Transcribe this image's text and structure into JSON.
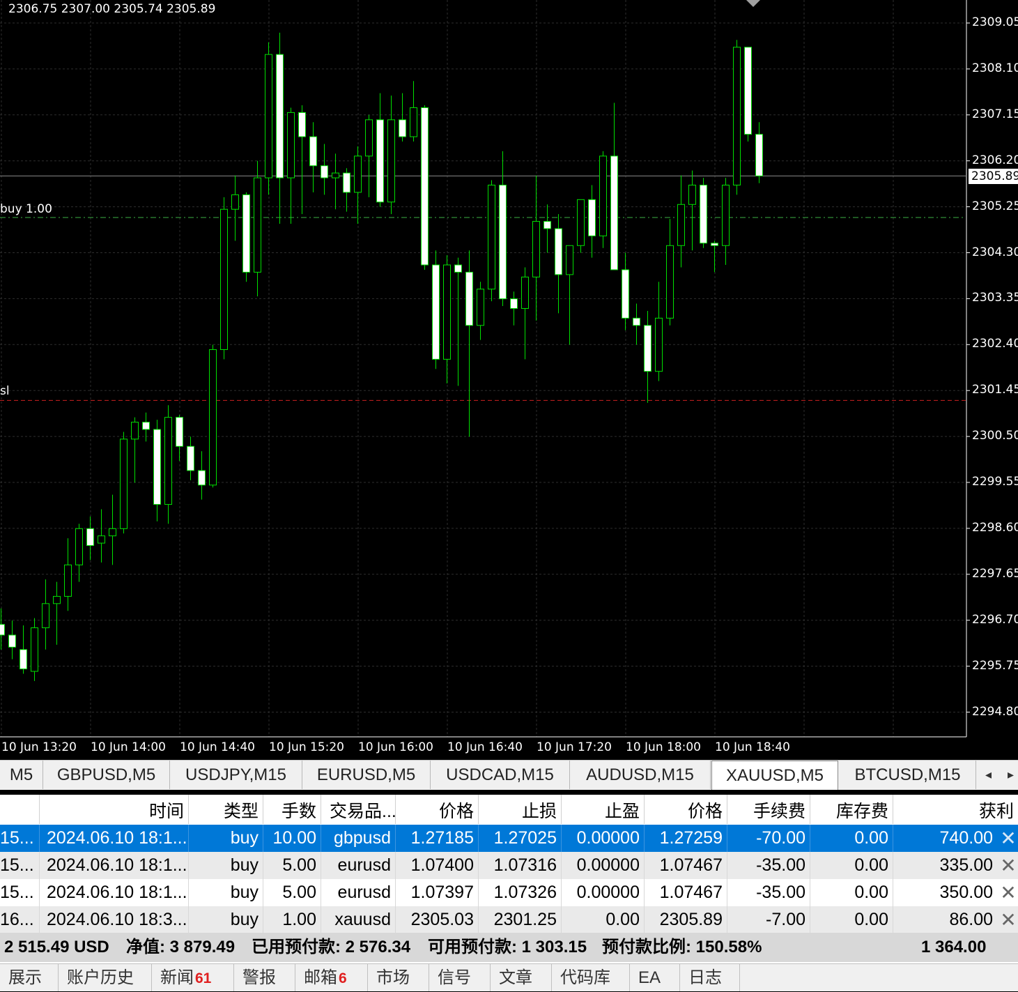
{
  "chart": {
    "ohlc_text": "2306.75 2307.00 2305.74 2305.89",
    "bid_price": "2305.89",
    "order_line_label": "buy 1.00",
    "sl_line_label": "sl",
    "y_labels": [
      "2309.05",
      "2308.10",
      "2307.15",
      "2306.20",
      "2305.25",
      "2304.30",
      "2303.35",
      "2302.40",
      "2301.45",
      "2300.50",
      "2299.55",
      "2298.60",
      "2297.65",
      "2296.70",
      "2295.75",
      "2294.80"
    ],
    "x_labels": [
      "10 Jun 13:20",
      "10 Jun 14:00",
      "10 Jun 14:40",
      "10 Jun 15:20",
      "10 Jun 16:00",
      "10 Jun 16:40",
      "10 Jun 17:20",
      "10 Jun 18:00",
      "10 Jun 18:40"
    ],
    "colors": {
      "background": "#000000",
      "grid": "#2e2e2e",
      "candle_outline": "#00e000",
      "bull_body": "#000000",
      "bear_body": "#ffffff",
      "order_line": "#3cb043",
      "sl_line": "#cc2020"
    }
  },
  "chart_data": {
    "type": "candlestick",
    "symbol": "XAUUSD",
    "timeframe": "M5",
    "ylim": [
      2294.3,
      2309.4
    ],
    "order_level": 2305.03,
    "sl_level": 2301.25,
    "bid": 2305.89,
    "candles": [
      {
        "o": 2296.62,
        "h": 2296.95,
        "l": 2296.1,
        "c": 2296.4
      },
      {
        "o": 2296.4,
        "h": 2296.7,
        "l": 2295.9,
        "c": 2296.15
      },
      {
        "o": 2296.1,
        "h": 2296.6,
        "l": 2295.6,
        "c": 2295.7
      },
      {
        "o": 2295.65,
        "h": 2296.75,
        "l": 2295.45,
        "c": 2296.55
      },
      {
        "o": 2296.55,
        "h": 2297.55,
        "l": 2296.1,
        "c": 2297.05
      },
      {
        "o": 2297.05,
        "h": 2297.5,
        "l": 2296.2,
        "c": 2297.2
      },
      {
        "o": 2297.2,
        "h": 2298.4,
        "l": 2296.9,
        "c": 2297.85
      },
      {
        "o": 2297.85,
        "h": 2298.7,
        "l": 2297.5,
        "c": 2298.6
      },
      {
        "o": 2298.6,
        "h": 2298.85,
        "l": 2297.95,
        "c": 2298.25
      },
      {
        "o": 2298.3,
        "h": 2299.0,
        "l": 2297.9,
        "c": 2298.45
      },
      {
        "o": 2298.45,
        "h": 2299.3,
        "l": 2297.85,
        "c": 2298.6
      },
      {
        "o": 2298.6,
        "h": 2300.6,
        "l": 2298.5,
        "c": 2300.45
      },
      {
        "o": 2300.45,
        "h": 2300.9,
        "l": 2299.55,
        "c": 2300.8
      },
      {
        "o": 2300.8,
        "h": 2301.0,
        "l": 2300.4,
        "c": 2300.65
      },
      {
        "o": 2300.65,
        "h": 2300.85,
        "l": 2298.75,
        "c": 2299.1
      },
      {
        "o": 2299.1,
        "h": 2301.15,
        "l": 2298.7,
        "c": 2300.9
      },
      {
        "o": 2300.9,
        "h": 2300.95,
        "l": 2300.0,
        "c": 2300.3
      },
      {
        "o": 2300.3,
        "h": 2300.5,
        "l": 2299.6,
        "c": 2299.8
      },
      {
        "o": 2299.8,
        "h": 2300.2,
        "l": 2299.2,
        "c": 2299.5
      },
      {
        "o": 2299.5,
        "h": 2302.4,
        "l": 2299.45,
        "c": 2302.3
      },
      {
        "o": 2302.3,
        "h": 2305.45,
        "l": 2302.1,
        "c": 2305.2
      },
      {
        "o": 2305.2,
        "h": 2305.9,
        "l": 2304.55,
        "c": 2305.5
      },
      {
        "o": 2305.5,
        "h": 2305.55,
        "l": 2303.7,
        "c": 2303.9
      },
      {
        "o": 2303.9,
        "h": 2306.2,
        "l": 2303.4,
        "c": 2305.85
      },
      {
        "o": 2305.85,
        "h": 2308.65,
        "l": 2305.5,
        "c": 2308.4
      },
      {
        "o": 2308.4,
        "h": 2308.85,
        "l": 2304.9,
        "c": 2305.85
      },
      {
        "o": 2305.85,
        "h": 2307.3,
        "l": 2304.9,
        "c": 2307.2
      },
      {
        "o": 2307.2,
        "h": 2307.35,
        "l": 2305.1,
        "c": 2306.7
      },
      {
        "o": 2306.7,
        "h": 2307.0,
        "l": 2305.55,
        "c": 2306.1
      },
      {
        "o": 2306.1,
        "h": 2306.55,
        "l": 2305.5,
        "c": 2305.85
      },
      {
        "o": 2305.85,
        "h": 2306.35,
        "l": 2305.2,
        "c": 2305.95
      },
      {
        "o": 2305.95,
        "h": 2306.05,
        "l": 2305.15,
        "c": 2305.55
      },
      {
        "o": 2305.55,
        "h": 2306.5,
        "l": 2304.9,
        "c": 2306.3
      },
      {
        "o": 2306.3,
        "h": 2307.15,
        "l": 2305.45,
        "c": 2307.05
      },
      {
        "o": 2307.05,
        "h": 2307.6,
        "l": 2305.25,
        "c": 2305.35
      },
      {
        "o": 2305.35,
        "h": 2307.55,
        "l": 2305.1,
        "c": 2307.05
      },
      {
        "o": 2307.05,
        "h": 2307.6,
        "l": 2306.6,
        "c": 2306.7
      },
      {
        "o": 2306.7,
        "h": 2307.85,
        "l": 2306.6,
        "c": 2307.3
      },
      {
        "o": 2307.3,
        "h": 2307.35,
        "l": 2303.95,
        "c": 2304.05
      },
      {
        "o": 2304.05,
        "h": 2304.35,
        "l": 2301.9,
        "c": 2302.1
      },
      {
        "o": 2302.1,
        "h": 2304.25,
        "l": 2301.6,
        "c": 2304.05
      },
      {
        "o": 2304.05,
        "h": 2304.2,
        "l": 2301.55,
        "c": 2303.9
      },
      {
        "o": 2303.9,
        "h": 2304.35,
        "l": 2300.5,
        "c": 2302.8
      },
      {
        "o": 2302.8,
        "h": 2303.7,
        "l": 2302.5,
        "c": 2303.55
      },
      {
        "o": 2303.55,
        "h": 2305.8,
        "l": 2303.3,
        "c": 2305.7
      },
      {
        "o": 2305.7,
        "h": 2306.4,
        "l": 2303.2,
        "c": 2303.35
      },
      {
        "o": 2303.35,
        "h": 2303.5,
        "l": 2302.8,
        "c": 2303.15
      },
      {
        "o": 2303.15,
        "h": 2304.0,
        "l": 2302.1,
        "c": 2303.8
      },
      {
        "o": 2303.8,
        "h": 2305.9,
        "l": 2302.9,
        "c": 2304.95
      },
      {
        "o": 2304.95,
        "h": 2305.3,
        "l": 2304.3,
        "c": 2304.8
      },
      {
        "o": 2304.8,
        "h": 2305.1,
        "l": 2303.05,
        "c": 2303.85
      },
      {
        "o": 2303.85,
        "h": 2304.4,
        "l": 2302.4,
        "c": 2304.45
      },
      {
        "o": 2304.45,
        "h": 2305.4,
        "l": 2304.3,
        "c": 2305.4
      },
      {
        "o": 2305.4,
        "h": 2305.7,
        "l": 2304.2,
        "c": 2304.65
      },
      {
        "o": 2304.65,
        "h": 2306.4,
        "l": 2304.4,
        "c": 2306.3
      },
      {
        "o": 2306.3,
        "h": 2307.4,
        "l": 2303.95,
        "c": 2303.95
      },
      {
        "o": 2303.95,
        "h": 2304.3,
        "l": 2302.7,
        "c": 2302.95
      },
      {
        "o": 2302.95,
        "h": 2303.25,
        "l": 2302.4,
        "c": 2302.8
      },
      {
        "o": 2302.8,
        "h": 2303.1,
        "l": 2301.2,
        "c": 2301.85
      },
      {
        "o": 2301.85,
        "h": 2303.7,
        "l": 2301.65,
        "c": 2302.95
      },
      {
        "o": 2302.95,
        "h": 2305.0,
        "l": 2302.8,
        "c": 2304.45
      },
      {
        "o": 2304.45,
        "h": 2305.9,
        "l": 2304.0,
        "c": 2305.3
      },
      {
        "o": 2305.3,
        "h": 2306.0,
        "l": 2304.35,
        "c": 2305.7
      },
      {
        "o": 2305.7,
        "h": 2305.85,
        "l": 2304.4,
        "c": 2304.5
      },
      {
        "o": 2304.5,
        "h": 2304.55,
        "l": 2303.9,
        "c": 2304.45
      },
      {
        "o": 2304.45,
        "h": 2305.85,
        "l": 2304.05,
        "c": 2305.7
      },
      {
        "o": 2305.7,
        "h": 2308.7,
        "l": 2305.5,
        "c": 2308.55
      },
      {
        "o": 2308.55,
        "h": 2308.55,
        "l": 2306.6,
        "c": 2306.75
      },
      {
        "o": 2306.75,
        "h": 2307.0,
        "l": 2305.74,
        "c": 2305.89
      }
    ]
  },
  "symbol_tabs": [
    {
      "label": "M5"
    },
    {
      "label": "GBPUSD,M5"
    },
    {
      "label": "USDJPY,M15"
    },
    {
      "label": "EURUSD,M5"
    },
    {
      "label": "USDCAD,M15"
    },
    {
      "label": "AUDUSD,M15"
    },
    {
      "label": "XAUUSD,M5",
      "active": true
    },
    {
      "label": "BTCUSD,M15"
    }
  ],
  "tab_arrows": {
    "left": "◂",
    "right": "▸"
  },
  "terminal": {
    "headers": [
      "",
      "时间",
      "类型",
      "手数",
      "交易品...",
      "价格",
      "止损",
      "止盈",
      "价格",
      "手续费",
      "库存费",
      "获利"
    ],
    "rows": [
      [
        "15...",
        "2024.06.10 18:1...",
        "buy",
        "10.00",
        "gbpusd",
        "1.27185",
        "1.27025",
        "0.00000",
        "1.27259",
        "-70.00",
        "0.00",
        "740.00"
      ],
      [
        "15...",
        "2024.06.10 18:1...",
        "buy",
        "5.00",
        "eurusd",
        "1.07400",
        "1.07316",
        "0.00000",
        "1.07467",
        "-35.00",
        "0.00",
        "335.00"
      ],
      [
        "15...",
        "2024.06.10 18:1...",
        "buy",
        "5.00",
        "eurusd",
        "1.07397",
        "1.07326",
        "0.00000",
        "1.07467",
        "-35.00",
        "0.00",
        "350.00"
      ],
      [
        "16...",
        "2024.06.10 18:3...",
        "buy",
        "1.00",
        "xauusd",
        "2305.03",
        "2301.25",
        "0.00",
        "2305.89",
        "-7.00",
        "0.00",
        "86.00"
      ]
    ],
    "close_glyph": "✕",
    "summary": {
      "balance": "2 515.49 USD",
      "equity": "净值: 3 879.49",
      "margin": "已用预付款: 2 576.34",
      "free_margin": "可用预付款: 1 303.15",
      "margin_level": "预付款比例: 150.58%",
      "total_profit": "1 364.00"
    }
  },
  "bottom_tabs": [
    {
      "label": "展示"
    },
    {
      "label": "账户历史"
    },
    {
      "label": "新闻",
      "badge": "61"
    },
    {
      "label": "警报"
    },
    {
      "label": "邮箱",
      "badge": "6"
    },
    {
      "label": "市场"
    },
    {
      "label": "信号"
    },
    {
      "label": "文章"
    },
    {
      "label": "代码库"
    },
    {
      "label": "EA"
    },
    {
      "label": "日志"
    }
  ]
}
